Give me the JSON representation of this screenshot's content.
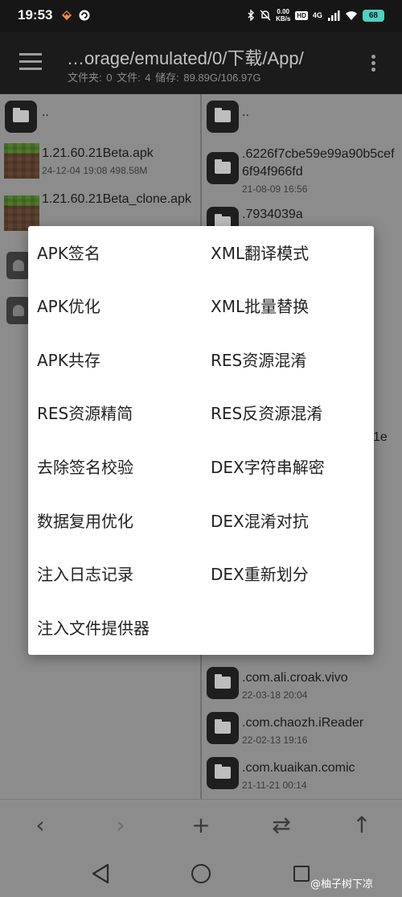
{
  "status_bar": {
    "time": "19:53",
    "net_speed_value": "0.00",
    "net_speed_unit": "KB/s",
    "hd": "HD",
    "network": "4G",
    "battery": "68"
  },
  "toolbar": {
    "path": "…orage/emulated/0/下载/App/",
    "info": "文件夹: 0  文件: 4  储存: 89.89G/106.97G"
  },
  "left_pane": {
    "up": "..",
    "files": [
      {
        "name": "1.21.60.21Beta.apk",
        "meta": "24-12-04 19:08  498.58M"
      },
      {
        "name": "1.21.60.21Beta_clone.apk",
        "meta": ""
      }
    ]
  },
  "right_pane": {
    "up": "..",
    "folders": [
      {
        "name": ".6226f7cbe59e99a90b5cef6f94f966fd",
        "meta": "21-08-09 16:56"
      },
      {
        "name": ".7934039a",
        "meta": ""
      },
      {
        "name": "1e",
        "meta": ""
      },
      {
        "name": ".com.ali.croak.vivo",
        "meta": "22-03-18 20:04"
      },
      {
        "name": ".com.chaozh.iReader",
        "meta": "22-02-13 19:16"
      },
      {
        "name": ".com.kuaikan.comic",
        "meta": "21-11-21 00:14"
      }
    ]
  },
  "dialog": {
    "options_left": [
      "APK签名",
      "APK优化",
      "APK共存",
      "RES资源精简",
      "去除签名校验",
      "数据复用优化",
      "注入日志记录",
      "注入文件提供器"
    ],
    "options_right": [
      "XML翻译模式",
      "XML批量替换",
      "RES资源混淆",
      "RES反资源混淆",
      "DEX字符串解密",
      "DEX混淆对抗",
      "DEX重新划分"
    ]
  },
  "action_bar": {
    "back_glyph": "‹",
    "forward_glyph": "›",
    "add_glyph": "+",
    "swap_glyph": "⇄",
    "up_glyph": "↑"
  },
  "watermark": "@柚子树下凉",
  "colors": {
    "statusbar_bg": "#161616",
    "toolbar_bg": "#1b1b1b",
    "dim_bg": "#8c8c8c",
    "dialog_bg": "#ffffff",
    "battery": "#4fd0c0"
  }
}
